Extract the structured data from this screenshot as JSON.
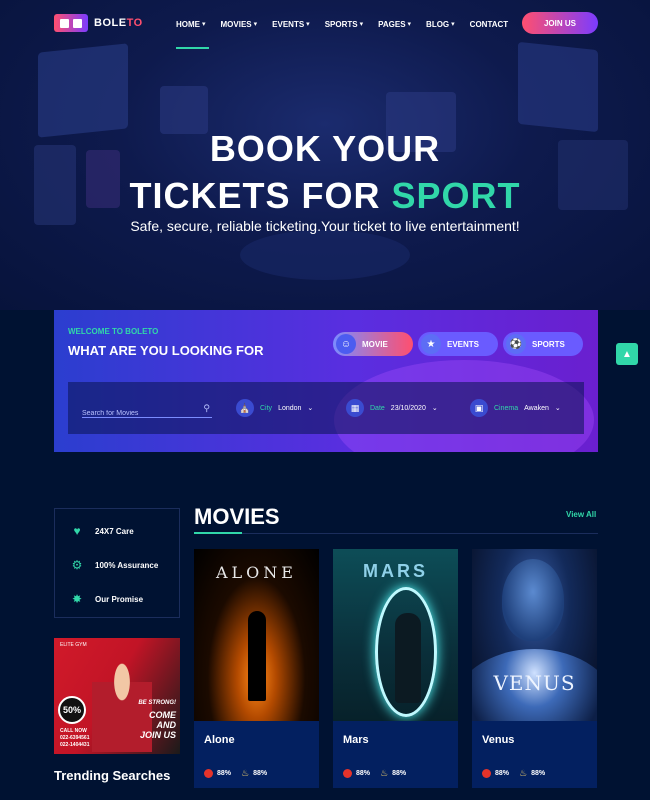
{
  "brand": {
    "name_main": "BOLE",
    "name_accent": "TO"
  },
  "nav": {
    "items": [
      {
        "label": "HOME",
        "chevron": true
      },
      {
        "label": "MOVIES",
        "chevron": true
      },
      {
        "label": "EVENTS",
        "chevron": true
      },
      {
        "label": "SPORTS",
        "chevron": true
      },
      {
        "label": "PAGES",
        "chevron": true
      },
      {
        "label": "BLOG",
        "chevron": true
      },
      {
        "label": "CONTACT",
        "chevron": false
      }
    ],
    "join_label": "JOIN US"
  },
  "hero": {
    "line1": "BOOK YOUR",
    "line2_prefix": "TICKETS FOR ",
    "line2_highlight": "SPORT",
    "subtitle": "Safe, secure, reliable ticketing.Your ticket to live entertainment!"
  },
  "search_panel": {
    "welcome": "WELCOME TO BOLETO",
    "title": "WHAT ARE YOU LOOKING FOR",
    "categories": [
      {
        "label": "MOVIE",
        "icon": "theater-masks-icon"
      },
      {
        "label": "EVENTS",
        "icon": "events-icon"
      },
      {
        "label": "SPORTS",
        "icon": "ball-icon"
      }
    ],
    "search_placeholder": "Search for Movies",
    "city": {
      "label": "City",
      "value": "London"
    },
    "date": {
      "label": "Date",
      "value": "23/10/2020"
    },
    "cinema": {
      "label": "Cinema",
      "value": "Awaken"
    }
  },
  "features": [
    {
      "label": "24X7 Care",
      "icon": "hand-heart-icon"
    },
    {
      "label": "100% Assurance",
      "icon": "award-icon"
    },
    {
      "label": "Our Promise",
      "icon": "medal-icon"
    }
  ],
  "promo": {
    "logo": "ELITE GYM",
    "percent": "50%",
    "be_strong": "BE STRONG!",
    "come_and": "COME AND",
    "join_us": "JOIN US",
    "call_now": "CALL NOW",
    "phone1": "022-6394561",
    "phone2": "022-1404431"
  },
  "trending_title": "Trending Searches",
  "movies": {
    "title": "MOVIES",
    "view_all": "View All",
    "items": [
      {
        "name": "Alone",
        "poster_title": "ALONE",
        "tomato": "88%",
        "audience": "88%"
      },
      {
        "name": "Mars",
        "poster_title": "MARS",
        "tomato": "88%",
        "audience": "88%"
      },
      {
        "name": "Venus",
        "poster_title": "VENUS",
        "tomato": "88%",
        "audience": "88%"
      }
    ]
  },
  "colors": {
    "accent": "#31d7a9",
    "brand_pink": "#ff4f6f",
    "brand_purple": "#7b3cff",
    "background": "#001232"
  }
}
